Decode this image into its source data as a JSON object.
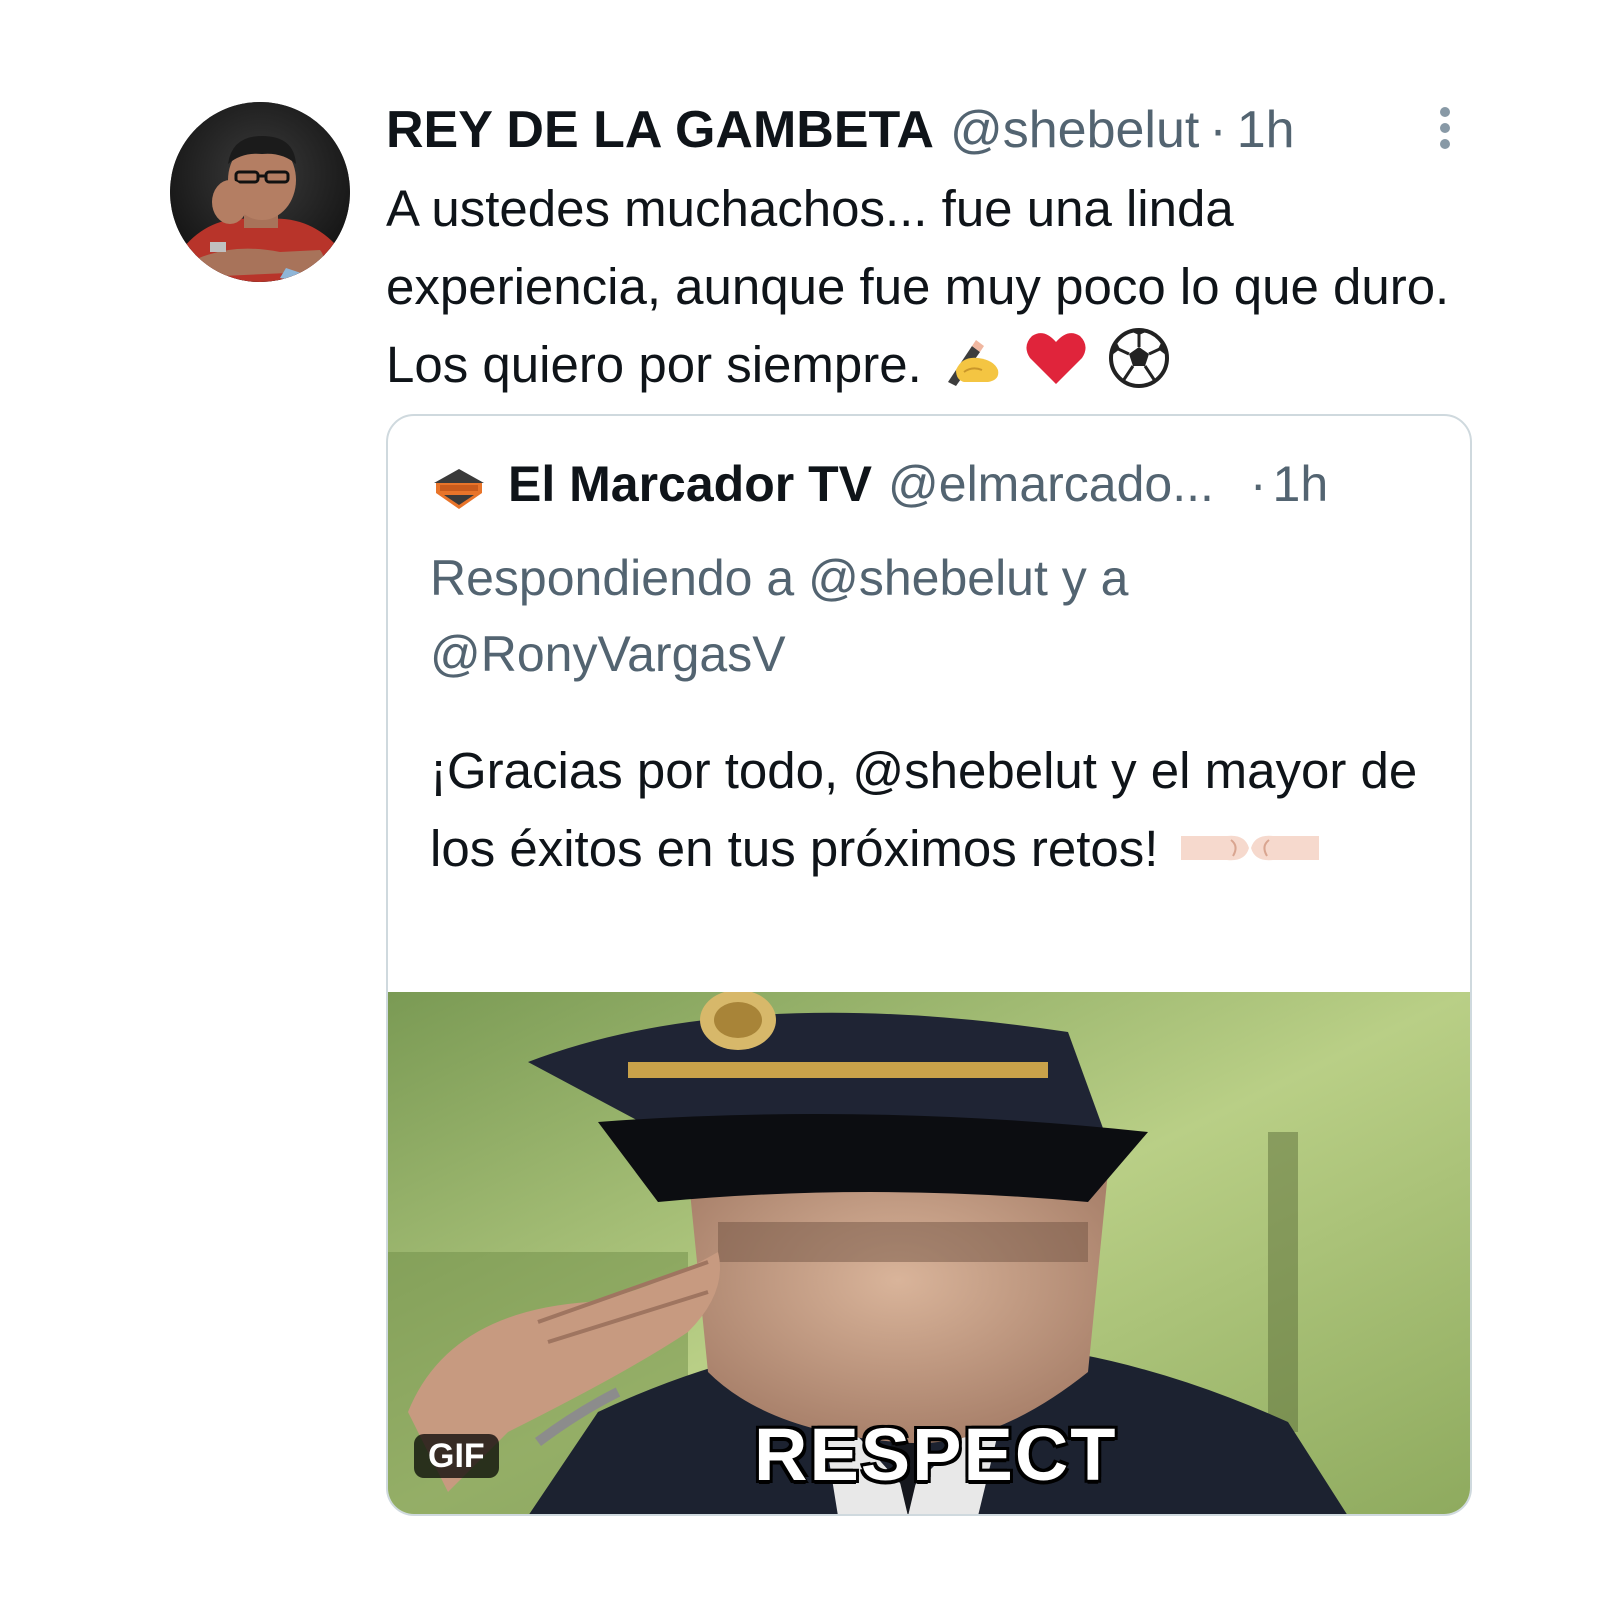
{
  "tweet": {
    "author_name": "REY DE LA GAMBETA",
    "author_handle": "@shebelut",
    "separator": "·",
    "time": "1h",
    "text": "A ustedes muchachos... fue una linda experiencia, aunque fue muy poco lo que duro. Los quiero por siempre.",
    "emojis": [
      "writing-hand-icon",
      "heart-icon",
      "soccer-ball-icon"
    ],
    "more_icon": "more-vertical-icon"
  },
  "quote": {
    "author_name": "El Marcador TV",
    "author_handle": "@elmarcado...",
    "separator": "·",
    "time": "1h",
    "replying_to": "Respondiendo a @shebelut y a @RonyVargasV",
    "text": "¡Gracias por todo, @shebelut y el mayor de los éxitos en tus próximos retos!",
    "emoji": "fist-bump-icon",
    "media": {
      "badge": "GIF",
      "caption": "RESPECT"
    }
  },
  "colors": {
    "text_primary": "#0f1419",
    "text_secondary": "#536471",
    "border": "#cfd9de",
    "heart": "#e0243b",
    "logo_orange": "#e8742a"
  }
}
